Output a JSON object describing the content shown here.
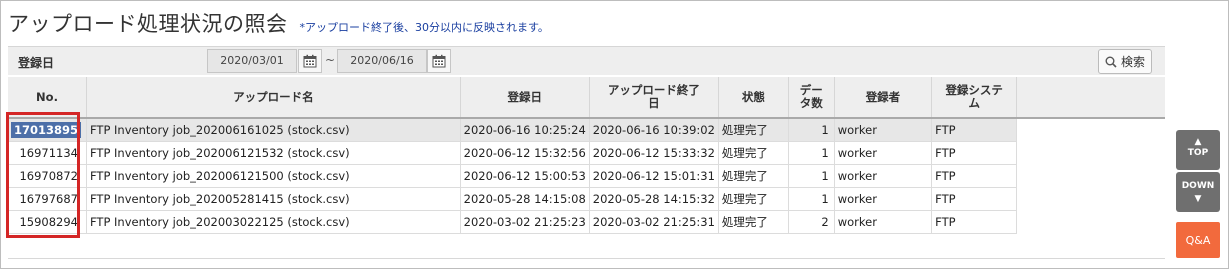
{
  "header": {
    "title": "アップロード処理状況の照会",
    "note": "*アップロード終了後、30分以内に反映されます。"
  },
  "filter": {
    "label": "登録日",
    "date_from": "2020/03/01",
    "separator": "~",
    "date_to": "2020/06/16",
    "search_label": "検索"
  },
  "table": {
    "columns": {
      "no": "No.",
      "name": "アップロード名",
      "registered": "登録日",
      "end_1": "アップロード終了",
      "end_2": "日",
      "status": "状態",
      "count_1": "デー",
      "count_2": "タ数",
      "registrant": "登録者",
      "system_1": "登録システ",
      "system_2": "ム"
    },
    "rows": [
      {
        "no": "17013895",
        "name": "FTP Inventory job_202006161025 (stock.csv)",
        "registered": "2020-06-16 10:25:24",
        "ended": "2020-06-16 10:39:02",
        "status": "処理完了",
        "count": "1",
        "registrant": "worker",
        "system": "FTP"
      },
      {
        "no": "16971134",
        "name": "FTP Inventory job_202006121532 (stock.csv)",
        "registered": "2020-06-12 15:32:56",
        "ended": "2020-06-12 15:33:32",
        "status": "処理完了",
        "count": "1",
        "registrant": "worker",
        "system": "FTP"
      },
      {
        "no": "16970872",
        "name": "FTP Inventory job_202006121500 (stock.csv)",
        "registered": "2020-06-12 15:00:53",
        "ended": "2020-06-12 15:01:31",
        "status": "処理完了",
        "count": "1",
        "registrant": "worker",
        "system": "FTP"
      },
      {
        "no": "16797687",
        "name": "FTP Inventory job_202005281415 (stock.csv)",
        "registered": "2020-05-28 14:15:08",
        "ended": "2020-05-28 14:15:32",
        "status": "処理完了",
        "count": "1",
        "registrant": "worker",
        "system": "FTP"
      },
      {
        "no": "15908294",
        "name": "FTP Inventory job_202003022125 (stock.csv)",
        "registered": "2020-03-02 21:25:23",
        "ended": "2020-03-02 21:25:31",
        "status": "処理完了",
        "count": "2",
        "registrant": "worker",
        "system": "FTP"
      }
    ]
  },
  "side": {
    "top_label": "TOP",
    "down_label": "DOWN",
    "qa_label": "Q&A"
  },
  "colors": {
    "selected_chip": "#4d6fa8",
    "highlight": "#d42626",
    "qa_button": "#f26a3d",
    "note_text": "#1a3fa0"
  },
  "icons": [
    "calendar-icon",
    "search-icon",
    "arrow-up-icon",
    "arrow-down-icon"
  ]
}
